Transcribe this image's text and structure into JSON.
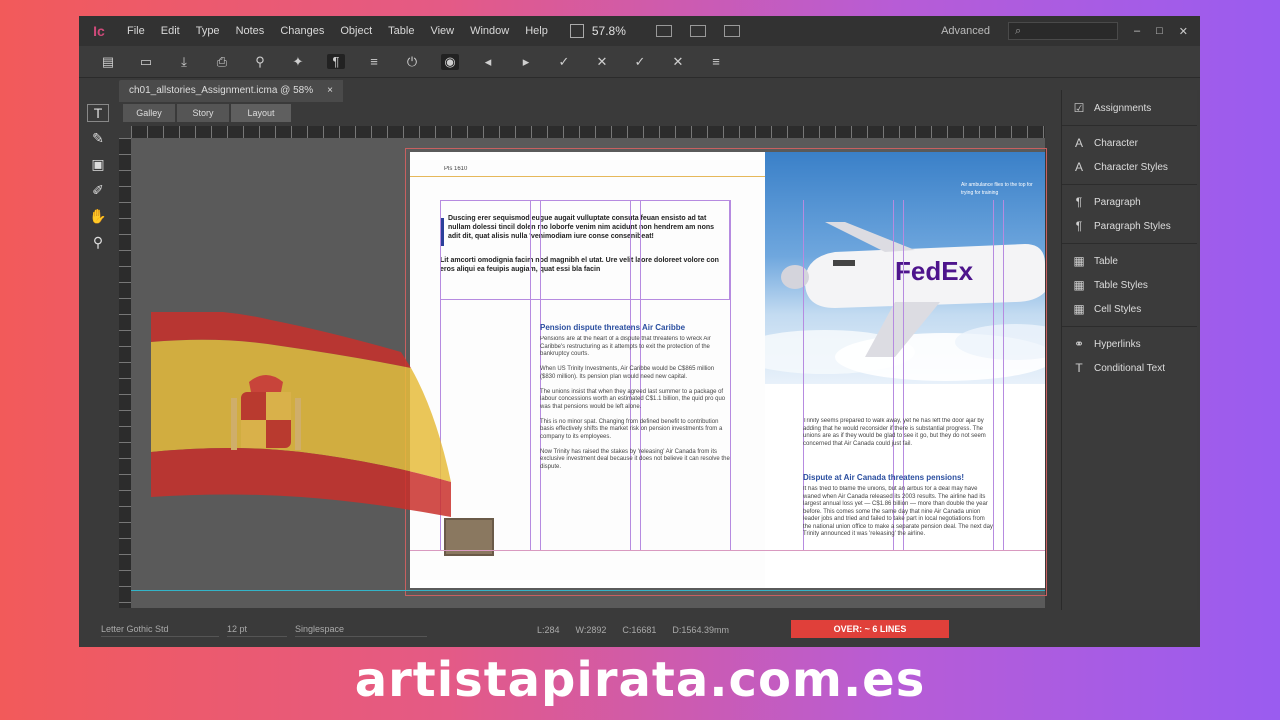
{
  "app": {
    "logo": "Ic"
  },
  "menu": [
    "File",
    "Edit",
    "Type",
    "Notes",
    "Changes",
    "Object",
    "Table",
    "View",
    "Window",
    "Help"
  ],
  "zoom": "57.8%",
  "workspace": "Advanced",
  "tab": {
    "title": "ch01_allstories_Assignment.icma @ 58%",
    "close": "×"
  },
  "view_tabs": [
    "Galley",
    "Story",
    "Layout"
  ],
  "page": {
    "slug": "Pls 1610",
    "intro": "Duscing erer sequismod eugue augait vulluptate consuta feuan ensisto ad tat nullam dolessi tincil dolen mo loborfe venim nim acidunt non hendrem am nons adit dit, quat alisis nulla 'venimodiam iure conse consenibeat!",
    "intro2": "Lit amcorti omodignia facim nod magnibh el utat. Ure velit laore doloreet volore con eros aliqui ea feuipis augiam, quat essi bla facin",
    "heading1": "Pension dispute threatens Air Caribbe",
    "body1": "Pensions are at the heart of a dispute that threatens to wreck Air Caribbe's restructuring as it attempts to exit the protection of the bankruptcy courts.\n\nWhen US Trinity Investments, Air Caribbe would be C$865 million ($830 million). Its pension plan would need new capital.\n\nThe unions insist that when they agreed last summer to a package of labour concessions worth an estimated C$1.1 billion, the quid pro quo was that pensions would be left alone.\n\nThis is no minor spat. Changing from defined benefit to contribution basis effectively shifts the market risk on pension investments from a company to its employees.\n\nNow Trinity has raised the stakes by 'releasing' Air Canada from its exclusive investment deal because it does not believe it can resolve the dispute.",
    "right_intro": "Trinity seems prepared to walk away, yet he has left the door ajar by adding that he would reconsider if there is substantial progress. The unions are as if they would be glad to see it go, but they do not seem concerned that Air Canada could just fail.",
    "heading2": "Dispute at Air Canada threatens pensions!",
    "body2": "It has tried to blame the unions, but an airbus for a deal may have waned when Air Canada released its 2003 results. The airline had its largest annual loss yet — C$1.86 billion — more than double the year before. This comes some the same day that nine Air Canada union leader jobs and tried and failed to take part in local negotiations from the national union office to make a separate pension deal. The next day Trinity announced it was 'releasing' the airline.",
    "caption": "Air ambulance flies to the top for trying for training",
    "brand": "FedEx"
  },
  "panel": [
    {
      "icon": "assignments-icon",
      "glyph": "☑",
      "label": "Assignments"
    },
    {
      "sep": true
    },
    {
      "icon": "character-icon",
      "glyph": "A",
      "label": "Character"
    },
    {
      "icon": "character-styles-icon",
      "glyph": "A",
      "label": "Character Styles"
    },
    {
      "sep": true
    },
    {
      "icon": "paragraph-icon",
      "glyph": "¶",
      "label": "Paragraph"
    },
    {
      "icon": "paragraph-styles-icon",
      "glyph": "¶",
      "label": "Paragraph Styles"
    },
    {
      "sep": true
    },
    {
      "icon": "table-icon",
      "glyph": "▦",
      "label": "Table"
    },
    {
      "icon": "table-styles-icon",
      "glyph": "▦",
      "label": "Table Styles"
    },
    {
      "icon": "cell-styles-icon",
      "glyph": "▦",
      "label": "Cell Styles"
    },
    {
      "sep": true
    },
    {
      "icon": "hyperlinks-icon",
      "glyph": "⚭",
      "label": "Hyperlinks"
    },
    {
      "icon": "conditional-text-icon",
      "glyph": "T",
      "label": "Conditional Text"
    }
  ],
  "status": {
    "font": "Letter Gothic Std",
    "size": "12 pt",
    "spacing": "Singlespace",
    "lines": "L:284",
    "words": "W:2892",
    "chars": "C:16681",
    "depth": "D:1564.39mm",
    "overset": "OVER: ~ 6 LINES"
  },
  "watermark": "artistapirata.com.es",
  "colors": {
    "overset": "#e0403a",
    "accent": "#d04a7a",
    "guide": "#b68be0"
  }
}
